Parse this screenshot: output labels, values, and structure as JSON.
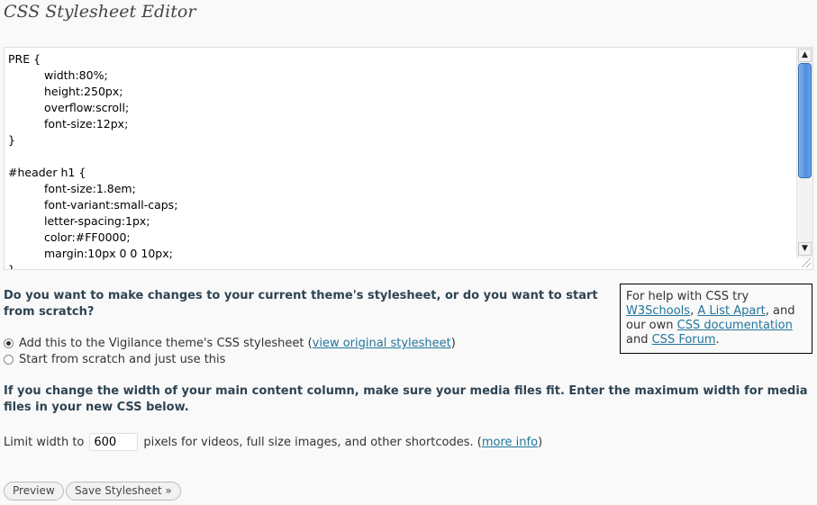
{
  "page": {
    "title": "CSS Stylesheet Editor"
  },
  "editor": {
    "lines": [
      {
        "text": "PRE {",
        "indent": false
      },
      {
        "text": "width:80%;",
        "indent": true
      },
      {
        "text": "height:250px;",
        "indent": true
      },
      {
        "text": "overflow:scroll;",
        "indent": true
      },
      {
        "text": "font-size:12px;",
        "indent": true
      },
      {
        "text": "}",
        "indent": false
      },
      {
        "text": "",
        "indent": false
      },
      {
        "text": "#header h1 {",
        "indent": false
      },
      {
        "text": "font-size:1.8em;",
        "indent": true
      },
      {
        "text": "font-variant:small-caps;",
        "indent": true
      },
      {
        "text": "letter-spacing:1px;",
        "indent": true
      },
      {
        "text": "color:#FF0000;",
        "indent": true
      },
      {
        "text": "margin:10px 0 0 10px;",
        "indent": true
      },
      {
        "text": "}",
        "indent": false
      }
    ]
  },
  "question": "Do you want to make changes to your current theme's stylesheet, or do you want to start from scratch?",
  "options": {
    "add": {
      "label": "Add this to the Vigilance theme's CSS stylesheet (",
      "link": "view original stylesheet",
      "suffix": ")",
      "selected": true
    },
    "scratch": {
      "label": "Start from scratch and just use this",
      "selected": false
    }
  },
  "help": {
    "prefix": "For help with CSS try",
    "link1": "W3Schools",
    "sep1": ",",
    "link2": "A List Apart",
    "mid": ", and our own",
    "link3": "CSS documentation",
    "and": "and",
    "link4": "CSS Forum",
    "end": "."
  },
  "width_note": "If you change the width of your main content column, make sure your media files fit. Enter the maximum width for media files in your new CSS below.",
  "limit": {
    "label": "Limit width to",
    "value": "600",
    "suffix": "pixels for videos, full size images, and other shortcodes. (",
    "link": "more info",
    "close": ")"
  },
  "buttons": {
    "preview": "Preview",
    "save": "Save Stylesheet »"
  }
}
